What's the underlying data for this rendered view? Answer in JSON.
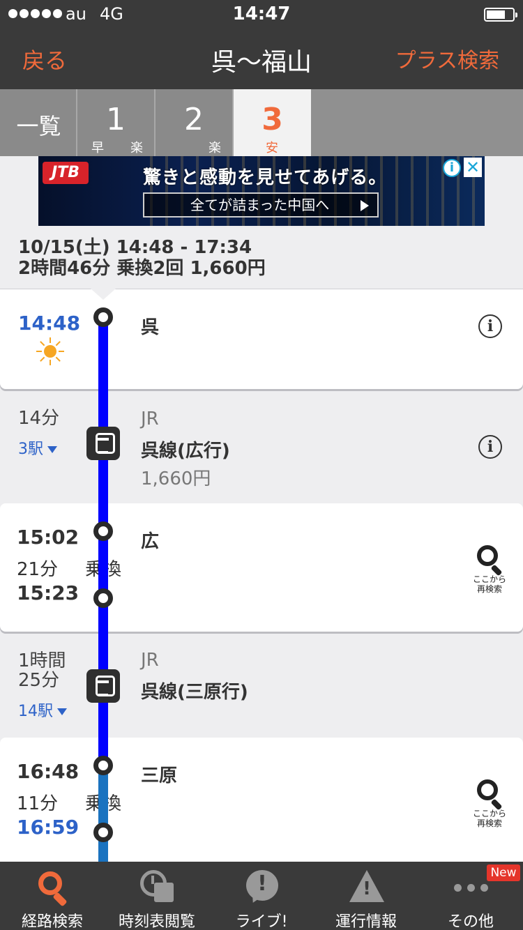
{
  "status_bar": {
    "carrier": "au",
    "network": "4G",
    "time": "14:47"
  },
  "nav": {
    "back": "戻る",
    "title": "呉〜福山",
    "plus_search": "プラス検索"
  },
  "tabs": {
    "list": "一覧",
    "routes": [
      {
        "num": "1",
        "tags": [
          "早",
          "楽"
        ]
      },
      {
        "num": "2",
        "tags": [
          "楽"
        ]
      },
      {
        "num": "3",
        "tags": [
          "安"
        ]
      }
    ]
  },
  "ad": {
    "logo": "JTB",
    "headline": "驚きと感動を見せてあげる。",
    "cta": "全てが詰まった中国へ",
    "info": "i",
    "close": "✕"
  },
  "summary": {
    "line1": "10/15(土) 14:48 - 17:34",
    "line2": "2時間46分 乗換2回 1,660円"
  },
  "stops": {
    "kure": {
      "time": "14:48",
      "name": "呉",
      "info": "i"
    },
    "hiro": {
      "arr": "15:02",
      "name": "広",
      "wait": "21分",
      "xfer": "乗換",
      "dep": "15:23",
      "research": "ここから\n再検索"
    },
    "mihara": {
      "arr": "16:48",
      "name": "三原",
      "wait": "11分",
      "xfer": "乗換",
      "dep": "16:59",
      "research": "ここから\n再検索"
    }
  },
  "segments": [
    {
      "duration": "14分",
      "stations": "3駅",
      "company": "JR",
      "line": "呉線(広行)",
      "fare": "1,660円",
      "info": "i"
    },
    {
      "duration_l1": "1時間",
      "duration_l2": "25分",
      "stations": "14駅",
      "company": "JR",
      "line": "呉線(三原行)"
    }
  ],
  "bottom_tabs": [
    {
      "label": "経路検索",
      "icon": "search-icon"
    },
    {
      "label": "時刻表閲覧",
      "icon": "timetable-icon"
    },
    {
      "label": "ライブ!",
      "icon": "live-icon"
    },
    {
      "label": "運行情報",
      "icon": "warning-icon"
    },
    {
      "label": "その他",
      "icon": "more-icon"
    }
  ],
  "badge": "New",
  "colors": {
    "accent": "#f06a3b",
    "route_line": "#0000ff",
    "time_blue": "#2d62c8",
    "bar": "#3a3a3a"
  }
}
